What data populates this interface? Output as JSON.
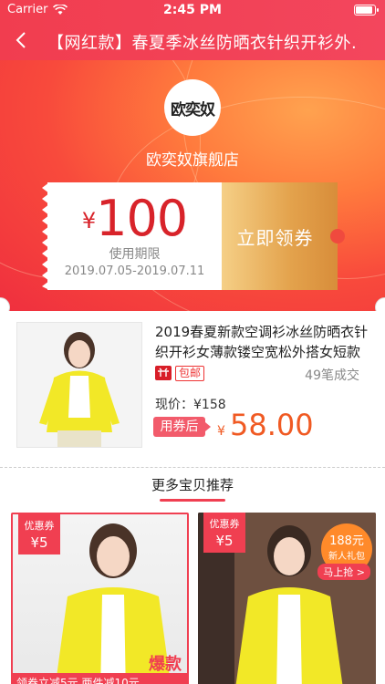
{
  "status": {
    "carrier": "Carrier",
    "time": "2:45 PM"
  },
  "nav": {
    "title": "【网红款】春夏季冰丝防晒衣针织开衫外..."
  },
  "shop": {
    "logo_text": "欧奕奴",
    "name": "欧奕奴旗舰店"
  },
  "coupon": {
    "currency": "¥",
    "amount": "100",
    "valid_label": "使用期限",
    "valid_dates": "2019.07.05-2019.07.11",
    "claim_label": "立即领券"
  },
  "product": {
    "title": "2019春夏新款空调衫冰丝防晒衣针织开衫女薄款镂空宽松外搭女短款",
    "free_shipping": "包邮",
    "sold": "49笔成交",
    "original_price": "现价：¥158",
    "after_coupon_label": "用券后",
    "final_currency": "¥",
    "final_price": "58.00"
  },
  "recommend": {
    "title": "更多宝贝推荐"
  },
  "cards": [
    {
      "tag_label": "优惠券",
      "tag_value": "¥5",
      "promo": "领券立减5元  两件减10元",
      "badge": "爆款"
    },
    {
      "tag_label": "优惠券",
      "tag_value": "¥5",
      "gift_amount": "188元",
      "gift_label": "新人礼包",
      "grab_label": "马上抢 >"
    }
  ],
  "colors": {
    "accent": "#f03f51",
    "price": "#f05a23",
    "coupon_gold": "#e3a24c"
  }
}
